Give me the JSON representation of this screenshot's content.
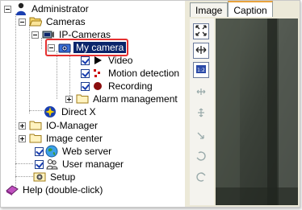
{
  "tree": {
    "root": {
      "label": "Administrator",
      "icon": "user-icon"
    },
    "cameras": {
      "label": "Cameras",
      "icon": "folder-open-icon"
    },
    "ip_cameras": {
      "label": "IP-Cameras",
      "icon": "ip-camera-icon"
    },
    "my_camera": {
      "label": "My camera",
      "icon": "camera-icon",
      "selected": true
    },
    "video": {
      "label": "Video",
      "checked": true,
      "icon": "play-icon"
    },
    "motion": {
      "label": "Motion detection",
      "checked": true,
      "icon": "motion-icon"
    },
    "recording": {
      "label": "Recording",
      "checked": true,
      "icon": "record-icon"
    },
    "alarm": {
      "label": "Alarm management",
      "icon": "folder-icon"
    },
    "directx": {
      "label": "Direct X",
      "icon": "directx-icon"
    },
    "io_manager": {
      "label": "IO-Manager",
      "icon": "folder-icon"
    },
    "image_center": {
      "label": "Image center",
      "icon": "folder-icon"
    },
    "web_server": {
      "label": "Web server",
      "checked": true,
      "icon": "globe-icon"
    },
    "user_manager": {
      "label": "User manager",
      "checked": true,
      "icon": "users-icon"
    },
    "setup": {
      "label": "Setup",
      "icon": "setup-icon"
    },
    "help": {
      "label": "Help (double-click)",
      "icon": "help-book-icon"
    }
  },
  "tabs": [
    {
      "label": "Image",
      "active": false
    },
    {
      "label": "Caption",
      "active": true
    }
  ],
  "toolbar": {
    "buttons": [
      {
        "name": "fit-icon",
        "active": true
      },
      {
        "name": "stretch-icon",
        "active": true
      },
      {
        "name": "zoom-icon",
        "active": true
      },
      {
        "name": "move-h-icon",
        "active": false
      },
      {
        "name": "move-v-icon",
        "active": false
      },
      {
        "name": "rotate-icon",
        "active": false
      },
      {
        "name": "rotate-cw-icon",
        "active": false
      },
      {
        "name": "rotate-ccw-icon",
        "active": false
      }
    ]
  },
  "colors": {
    "selection": "#0a246a",
    "highlight": "#e53030",
    "tab_accent": "#e8a33d"
  }
}
